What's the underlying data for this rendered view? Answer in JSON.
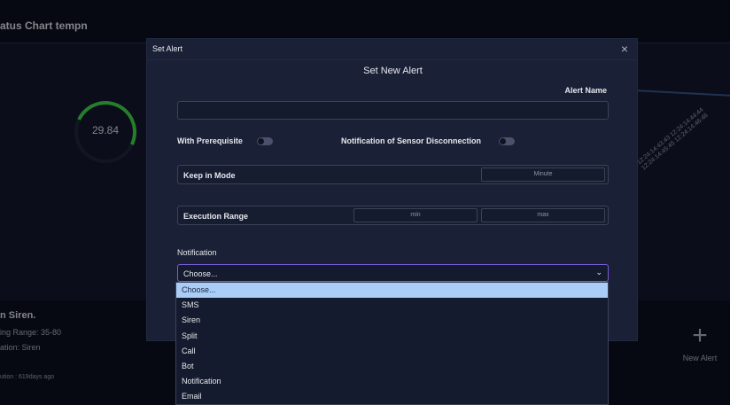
{
  "background": {
    "title": "atus Chart tempn",
    "gauge_value": "29.84",
    "chart_ticks": "12:24:14:43:43 12:24:14:44:44 12:24:14:45:45 12:24:14:46:46",
    "alert_card": {
      "title": "n Siren.",
      "range": "ing Range:  35-80",
      "action": "ation:  Siren",
      "ago": "ution :  619days ago"
    },
    "new_alert_label": "New Alert",
    "new_alert_icon": "plus-icon"
  },
  "modal": {
    "header_title": "Set Alert",
    "close_symbol": "×",
    "form_title": "Set New Alert",
    "alert_name_label": "Alert Name",
    "alert_name_value": "",
    "with_prerequisite_label": "With Prerequisite",
    "sensor_disconnection_label": "Notification of Sensor Disconnection",
    "keep_in_mode_label": "Keep in Mode",
    "keep_in_mode_placeholder": "Minute",
    "execution_range_label": "Execution Range",
    "min_placeholder": "min",
    "max_placeholder": "max",
    "notification_label": "Notification",
    "notification_selected": "Choose...",
    "chevron_symbol": "⌄"
  },
  "dropdown": {
    "options": [
      "Choose...",
      "SMS",
      "Siren",
      "Split",
      "Call",
      "Bot",
      "Notification",
      "Email"
    ],
    "selected_index": 0
  },
  "colors": {
    "accent_border": "#7b5cd6",
    "highlight": "#a9cdf7",
    "gauge": "#3ac341"
  }
}
